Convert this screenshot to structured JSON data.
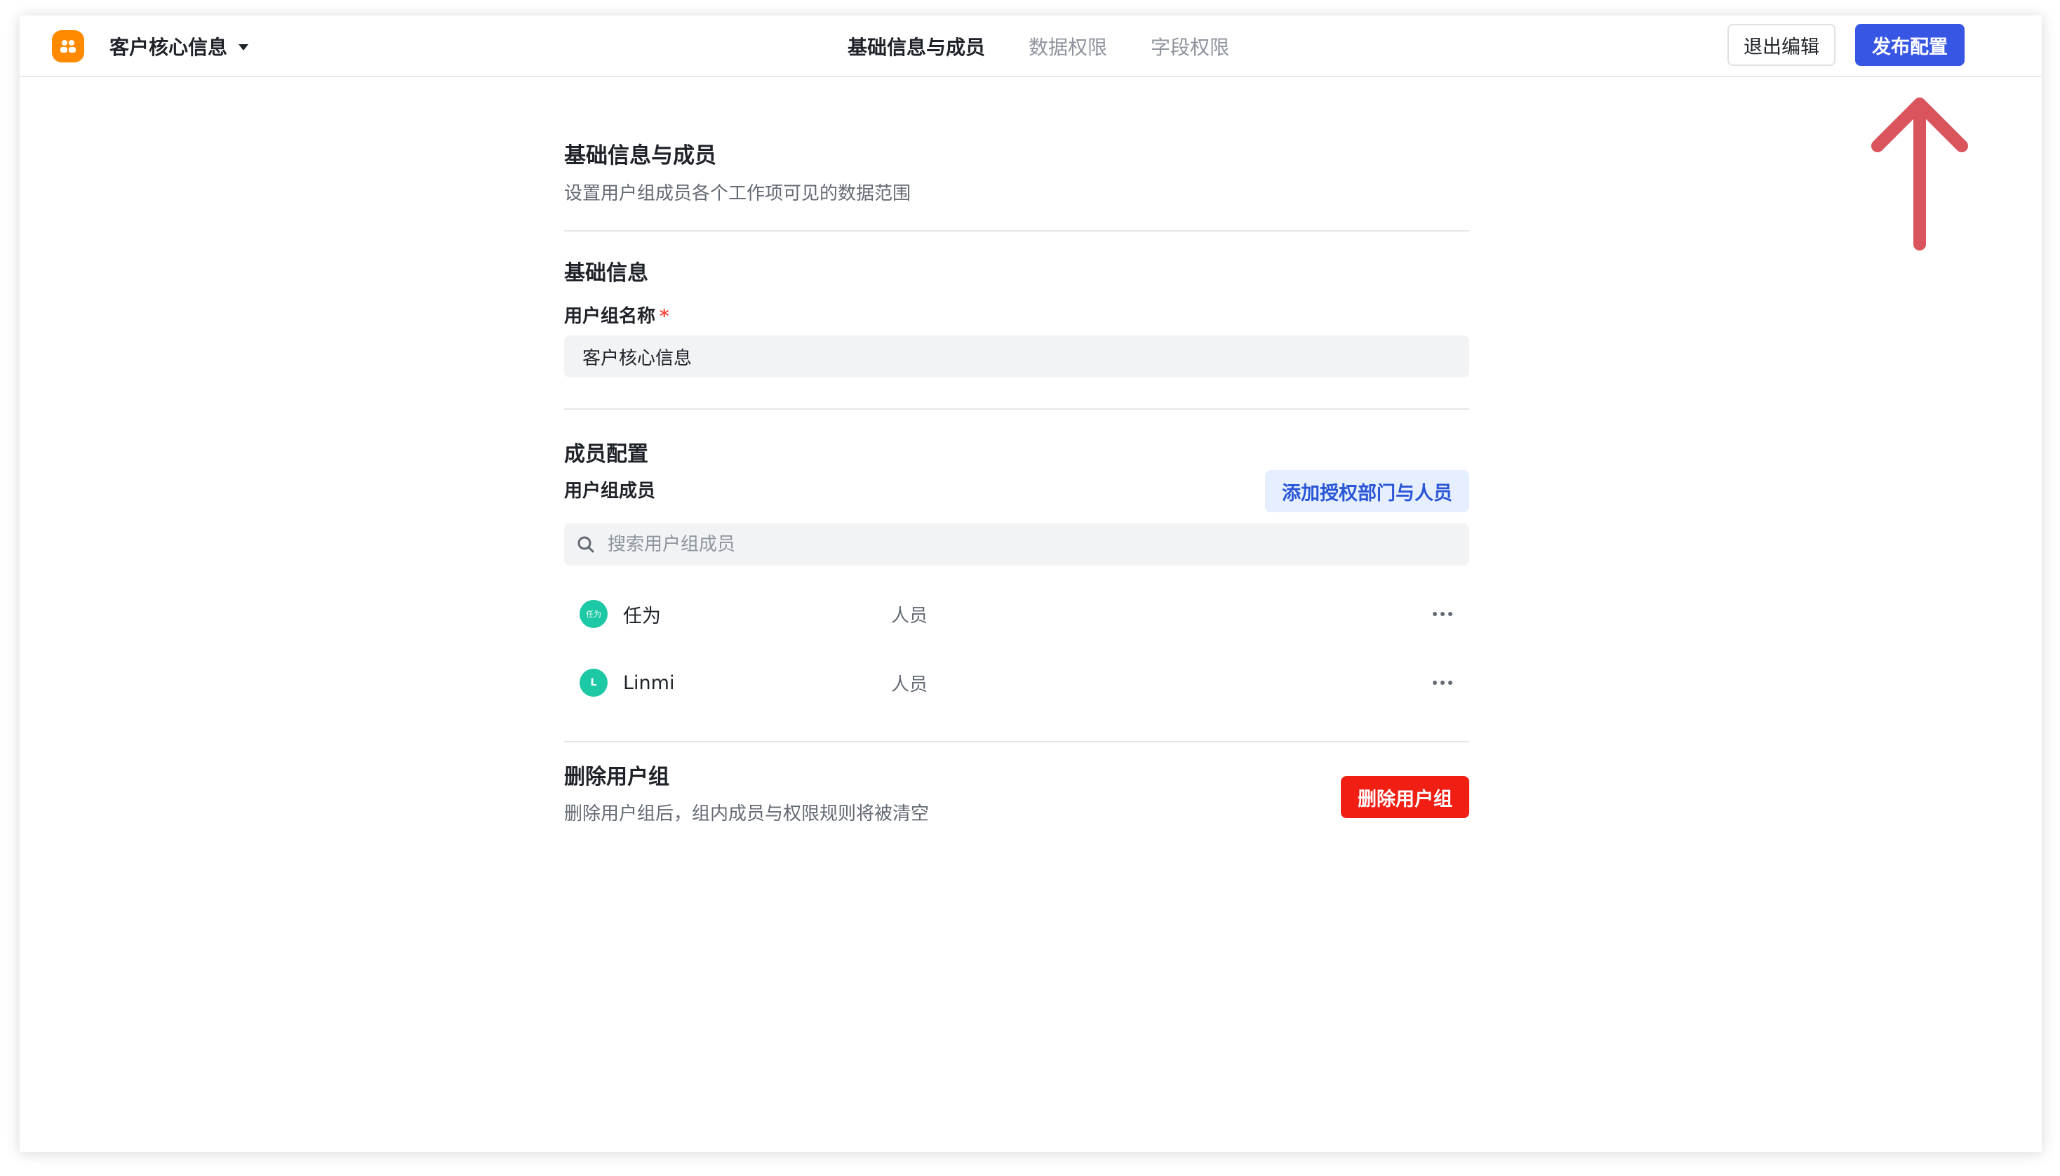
{
  "header": {
    "app_icon": "user-group-icon",
    "app_name": "客户核心信息",
    "tabs": [
      {
        "label": "基础信息与成员",
        "active": true
      },
      {
        "label": "数据权限",
        "active": false
      },
      {
        "label": "字段权限",
        "active": false
      }
    ],
    "exit_label": "退出编辑",
    "publish_label": "发布配置"
  },
  "section": {
    "title": "基础信息与成员",
    "subtitle": "设置用户组成员各个工作项可见的数据范围"
  },
  "basic": {
    "title": "基础信息",
    "name_label": "用户组名称",
    "required_mark": "*",
    "name_value": "客户核心信息"
  },
  "members": {
    "title": "成员配置",
    "list_label": "用户组成员",
    "add_label": "添加授权部门与人员",
    "search_placeholder": "搜索用户组成员",
    "items": [
      {
        "avatar": "任为",
        "name": "任为",
        "type": "人员"
      },
      {
        "avatar": "L",
        "name": "Linmi",
        "type": "人员"
      }
    ]
  },
  "danger": {
    "title": "删除用户组",
    "desc": "删除用户组后，组内成员与权限规则将被清空",
    "button_label": "删除用户组"
  },
  "colors": {
    "primary": "#3656e3",
    "danger": "#f01e13",
    "app_icon": "#ff8a00",
    "avatar": "#1dc8a4",
    "annotation_arrow": "#d9545c"
  }
}
